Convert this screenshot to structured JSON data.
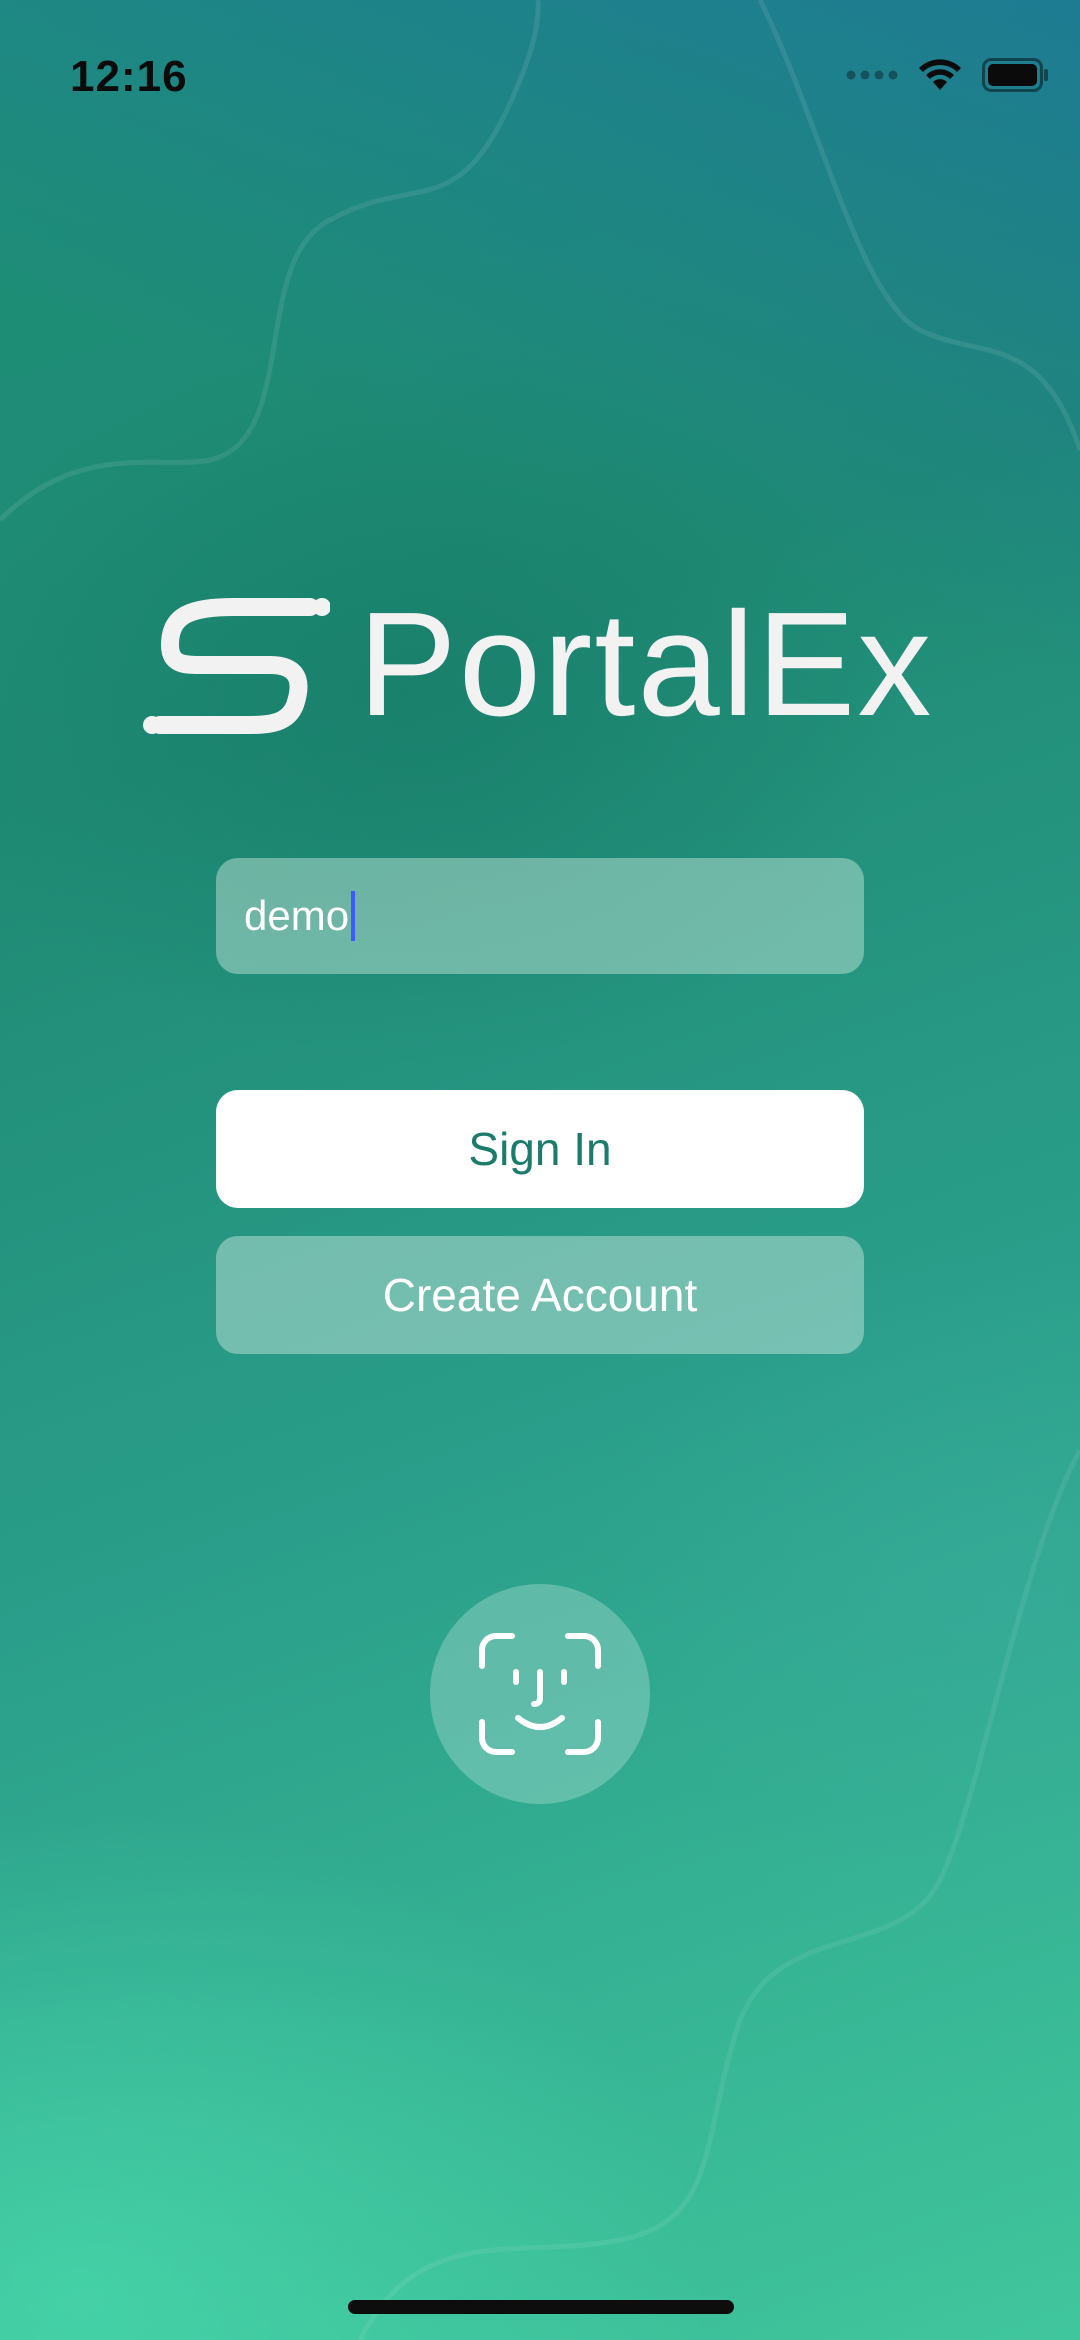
{
  "status_bar": {
    "time": "12:16"
  },
  "brand": {
    "name": "PortalEx"
  },
  "login": {
    "username_value": "demo",
    "sign_in_label": "Sign In",
    "create_account_label": "Create Account"
  },
  "icons": {
    "signal": "signal-dots-icon",
    "wifi": "wifi-icon",
    "battery": "battery-icon",
    "face_id": "face-id-icon",
    "logo": "portalex-logo-icon"
  },
  "colors": {
    "accent": "#1c7c6c",
    "caret": "#3b5bff"
  }
}
